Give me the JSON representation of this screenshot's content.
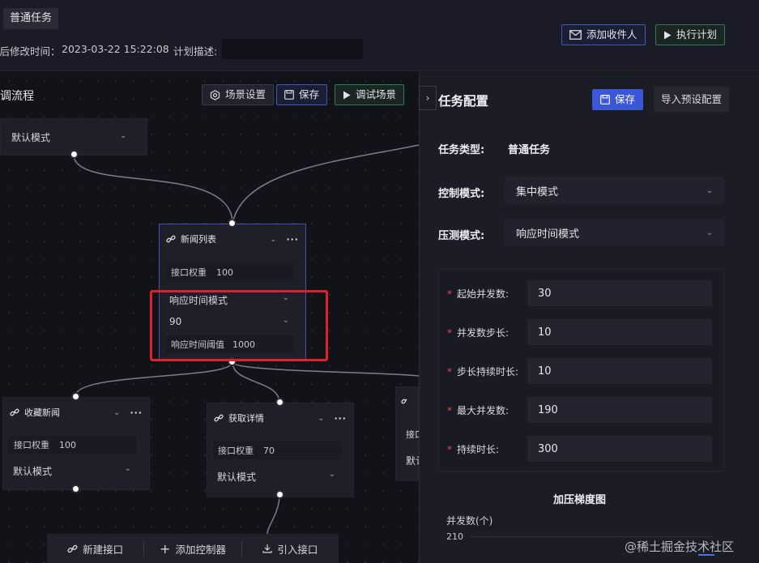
{
  "header": {
    "task_tag": "普通任务",
    "last_modified_label": "最后修改时间：",
    "last_modified_value": "2023-03-22 15:22:08",
    "plan_desc_label": "计划描述:",
    "add_recipient": "添加收件人",
    "execute_plan": "执行计划"
  },
  "flow": {
    "title": "调流程",
    "scene_settings": "场景设置",
    "save": "保存",
    "debug_scene": "调试场景",
    "top_node_mode": "默认模式",
    "main_node": {
      "title": "新闻列表",
      "weight_label": "接口权重",
      "weight_value": "100",
      "mode": "响应时间模式",
      "percentile": "90",
      "threshold_label": "响应时间阈值",
      "threshold_value": "1000"
    },
    "node_favorite": {
      "title": "收藏新闻",
      "weight_label": "接口权重",
      "weight_value": "100",
      "mode": "默认模式"
    },
    "node_detail": {
      "title": "获取详情",
      "weight_label": "接口权重",
      "weight_value": "70",
      "mode": "默认模式"
    },
    "node_partial": {
      "weight_label": "接口",
      "mode": "默认"
    },
    "bottom": {
      "new_api": "新建接口",
      "add_controller": "添加控制器",
      "import_api": "引入接口"
    }
  },
  "panel": {
    "title": "任务配置",
    "save": "保存",
    "import_preset": "导入预设配置",
    "task_type_label": "任务类型:",
    "task_type_value": "普通任务",
    "control_mode_label": "控制模式:",
    "control_mode_value": "集中模式",
    "pressure_mode_label": "压测模式:",
    "pressure_mode_value": "响应时间模式",
    "config": [
      {
        "label": "起始并发数:",
        "value": "30"
      },
      {
        "label": "并发数步长:",
        "value": "10"
      },
      {
        "label": "步长持续时长:",
        "value": "10"
      },
      {
        "label": "最大并发数:",
        "value": "190"
      },
      {
        "label": "持续时长:",
        "value": "300"
      }
    ],
    "chart_title": "加压梯度图",
    "chart_ylabel": "并发数(个)",
    "chart_tick_top": "210"
  },
  "watermark": "@稀土掘金技术社区"
}
